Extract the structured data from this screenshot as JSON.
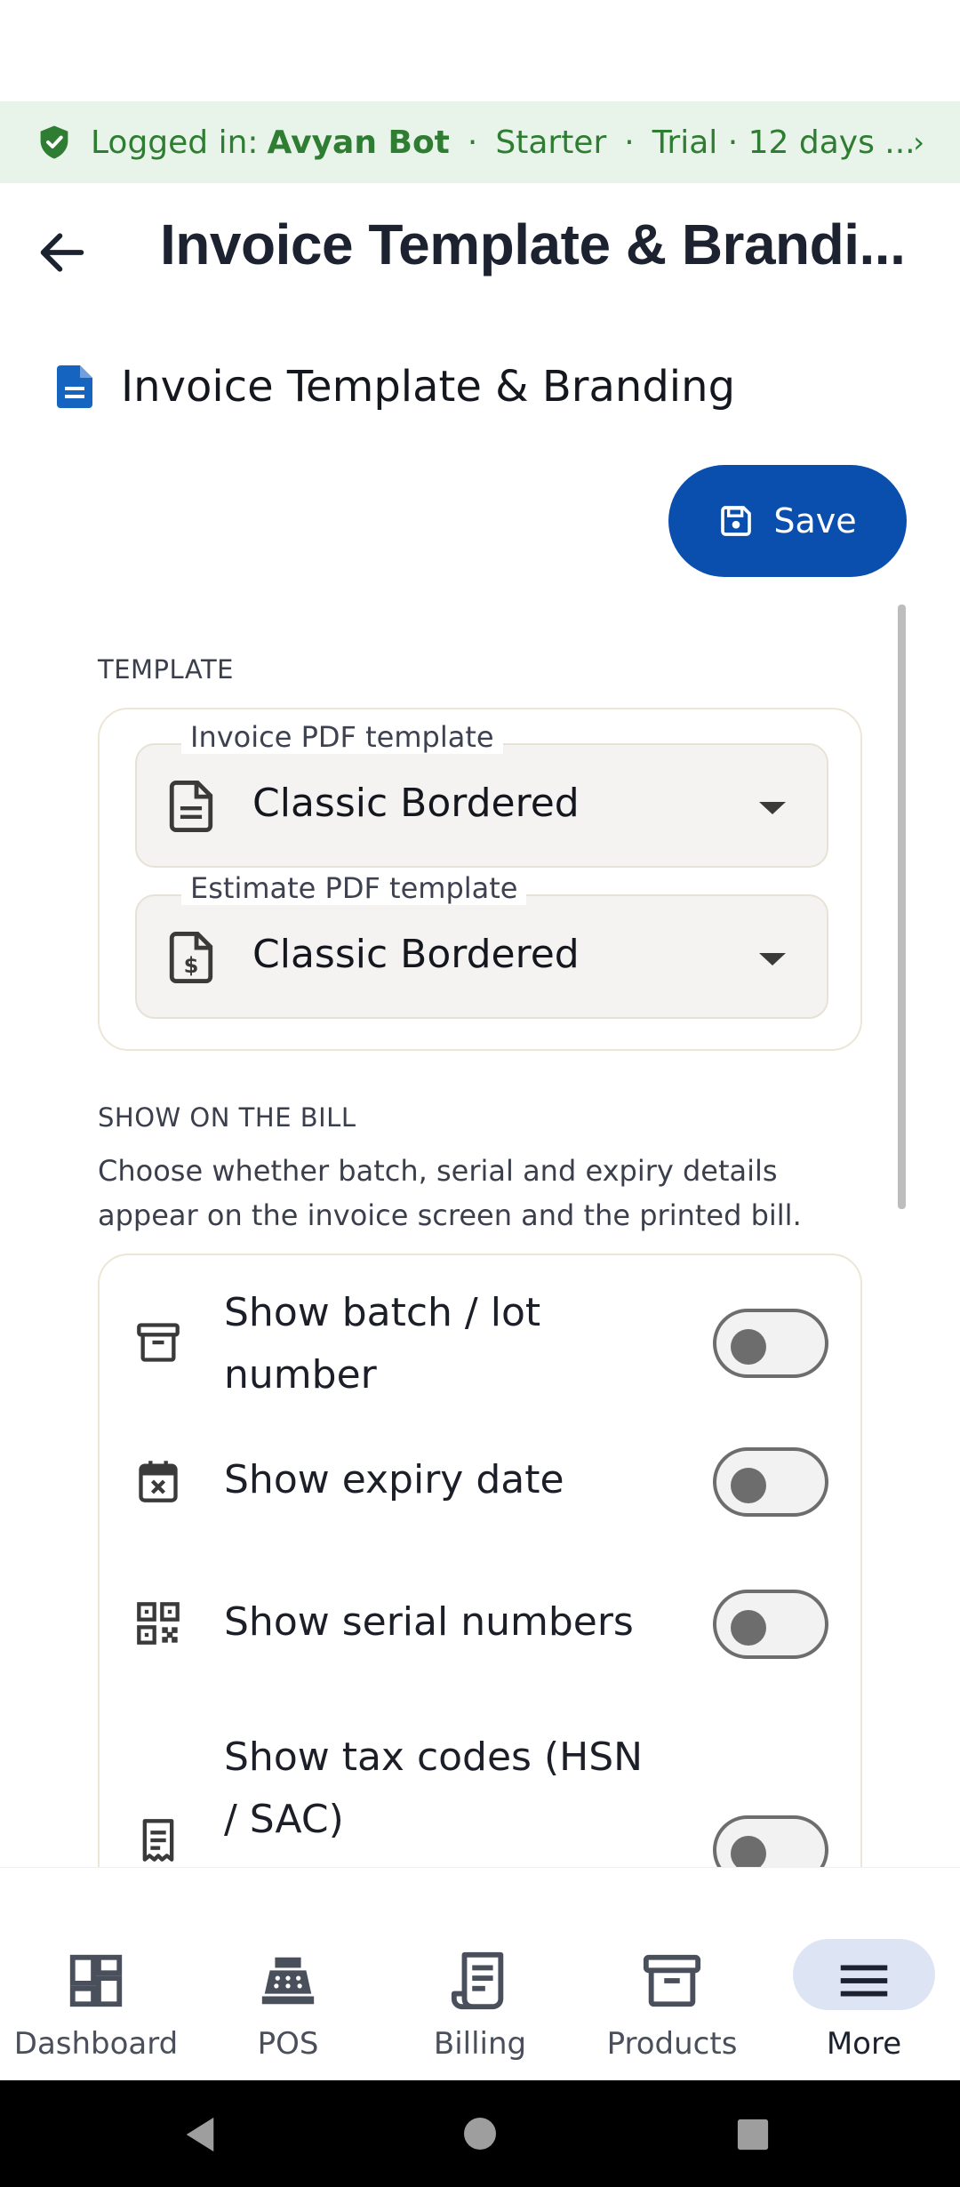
{
  "banner": {
    "prefix": "Logged in:",
    "user": "Avyan Bot",
    "plan": "Starter",
    "trial": "Trial · 12 days ..."
  },
  "appbar": {
    "title": "Invoice Template & Brandi..."
  },
  "page": {
    "heading": "Invoice Template & Branding",
    "save_label": "Save"
  },
  "template_section": {
    "label": "TEMPLATE",
    "invoice_field": {
      "label": "Invoice PDF template",
      "value": "Classic Bordered"
    },
    "estimate_field": {
      "label": "Estimate PDF template",
      "value": "Classic Bordered"
    }
  },
  "bill_section": {
    "label": "SHOW ON THE BILL",
    "description": "Choose whether batch, serial and expiry details appear on the invoice screen and the printed bill.",
    "toggles": [
      {
        "label": "Show batch / lot number",
        "icon": "archive-icon",
        "on": false
      },
      {
        "label": "Show expiry date",
        "icon": "calendar-x-icon",
        "on": false
      },
      {
        "label": "Show serial numbers",
        "icon": "qr-code-icon",
        "on": false
      },
      {
        "label": "Show tax codes (HSN / SAC)",
        "icon": "receipt-icon",
        "on": false
      }
    ]
  },
  "bottom_nav": [
    {
      "label": "Dashboard",
      "icon": "dashboard-icon",
      "active": false
    },
    {
      "label": "POS",
      "icon": "cash-register-icon",
      "active": false
    },
    {
      "label": "Billing",
      "icon": "receipt-icon",
      "active": false
    },
    {
      "label": "Products",
      "icon": "archive-icon",
      "active": false
    },
    {
      "label": "More",
      "icon": "menu-icon",
      "active": true
    }
  ],
  "colors": {
    "primary": "#0a4fae",
    "banner_bg": "#e8f4e9",
    "banner_text": "#2e7d32",
    "active_pill": "#dde4f3"
  }
}
